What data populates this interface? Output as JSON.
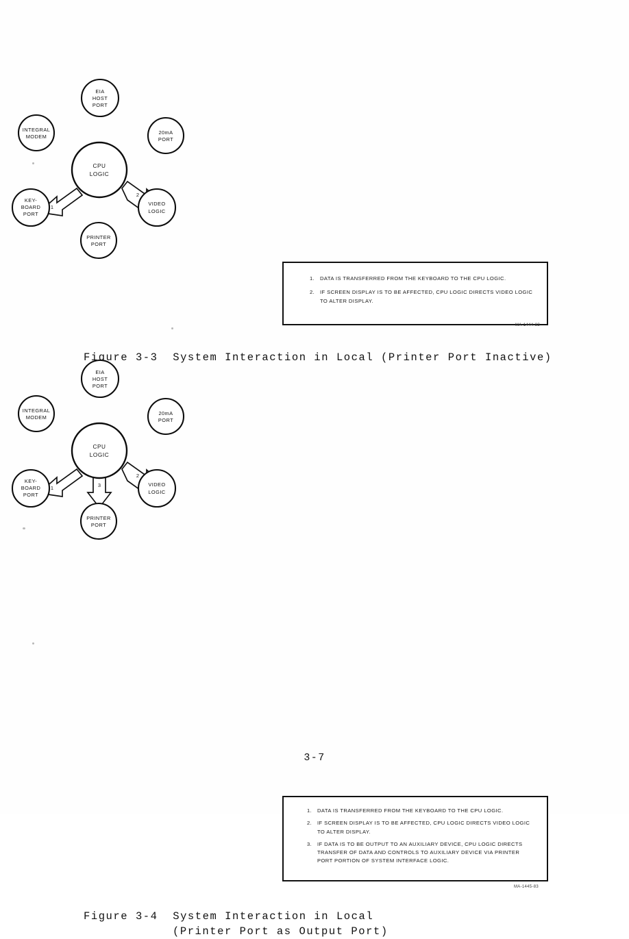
{
  "page": {
    "page_number": "3-7"
  },
  "figures": [
    {
      "id": "figure-3-3",
      "caption_line1": "Figure 3-3  System Interaction in Local (Printer Port Inactive)",
      "caption_line2": "",
      "drawing_code": "MA-1444-83",
      "nodes": {
        "hub": [
          "CPU",
          "LOGIC"
        ],
        "eia_host_port": [
          "EIA",
          "HOST",
          "PORT"
        ],
        "integral_modem": [
          "INTEGRAL",
          "MODEM"
        ],
        "ma_port": [
          "20mA",
          "PORT"
        ],
        "keyboard_port": [
          "KEY-",
          "BOARD",
          "PORT"
        ],
        "video_logic": [
          "VIDEO",
          "LOGIC"
        ],
        "printer_port": [
          "PRINTER",
          "PORT"
        ]
      },
      "arrows": [
        {
          "label": "1",
          "from": "keyboard_port",
          "to": "hub"
        },
        {
          "label": "2",
          "from": "hub",
          "to": "video_logic"
        }
      ],
      "notes": [
        {
          "num": "1.",
          "text": "DATA IS TRANSFERRED FROM THE KEYBOARD TO THE CPU LOGIC."
        },
        {
          "num": "2.",
          "text": "IF SCREEN DISPLAY IS TO BE AFFECTED, CPU LOGIC DIRECTS VIDEO LOGIC TO ALTER DISPLAY."
        }
      ]
    },
    {
      "id": "figure-3-4",
      "caption_line1": "Figure 3-4  System Interaction in Local",
      "caption_line2": "(Printer Port as Output Port)",
      "drawing_code": "MA-1445-83",
      "nodes": {
        "hub": [
          "CPU",
          "LOGIC"
        ],
        "eia_host_port": [
          "EIA",
          "HOST",
          "PORT"
        ],
        "integral_modem": [
          "INTEGRAL",
          "MODEM"
        ],
        "ma_port": [
          "20mA",
          "PORT"
        ],
        "keyboard_port": [
          "KEY-",
          "BOARD",
          "PORT"
        ],
        "video_logic": [
          "VIDEO",
          "LOGIC"
        ],
        "printer_port": [
          "PRINTER",
          "PORT"
        ]
      },
      "arrows": [
        {
          "label": "1",
          "from": "keyboard_port",
          "to": "hub"
        },
        {
          "label": "2",
          "from": "hub",
          "to": "video_logic"
        },
        {
          "label": "3",
          "from": "hub",
          "to": "printer_port"
        }
      ],
      "notes": [
        {
          "num": "1.",
          "text": "DATA IS TRANSFERRED FROM THE KEYBOARD TO THE CPU LOGIC."
        },
        {
          "num": "2.",
          "text": "IF SCREEN DISPLAY IS TO BE AFFECTED, CPU LOGIC DIRECTS VIDEO LOGIC TO ALTER DISPLAY."
        },
        {
          "num": "3.",
          "text": "IF DATA IS TO BE OUTPUT TO AN AUXILIARY DEVICE, CPU LOGIC DIRECTS TRANSFER OF DATA AND CONTROLS TO AUXILIARY DEVICE VIA PRINTER PORT PORTION OF SYSTEM INTERFACE LOGIC."
        }
      ]
    }
  ]
}
